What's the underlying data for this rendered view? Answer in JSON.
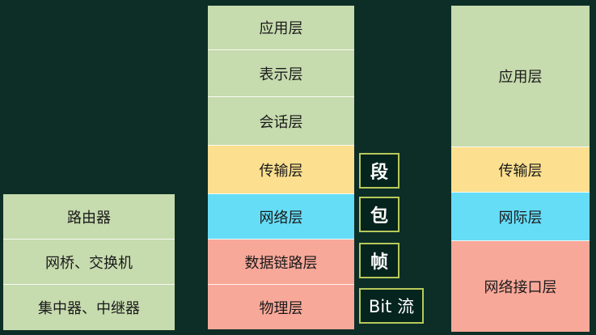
{
  "devices": {
    "items": [
      "路由器",
      "网桥、交换机",
      "集中器、中继器"
    ]
  },
  "osi": {
    "layers": [
      "应用层",
      "表示层",
      "会话层",
      "传输层",
      "网络层",
      "数据链路层",
      "物理层"
    ]
  },
  "pdu": {
    "units": [
      "段",
      "包",
      "帧",
      "Bit 流"
    ]
  },
  "tcpip": {
    "layers": [
      "应用层",
      "传输层",
      "网际层",
      "网络接口层"
    ]
  },
  "colors": {
    "background": "#0d2e27",
    "green": "#c6dbae",
    "yellow": "#fde08f",
    "cyan": "#66ddf7",
    "salmon": "#f8a899",
    "pdu_border": "#b7c95a"
  }
}
